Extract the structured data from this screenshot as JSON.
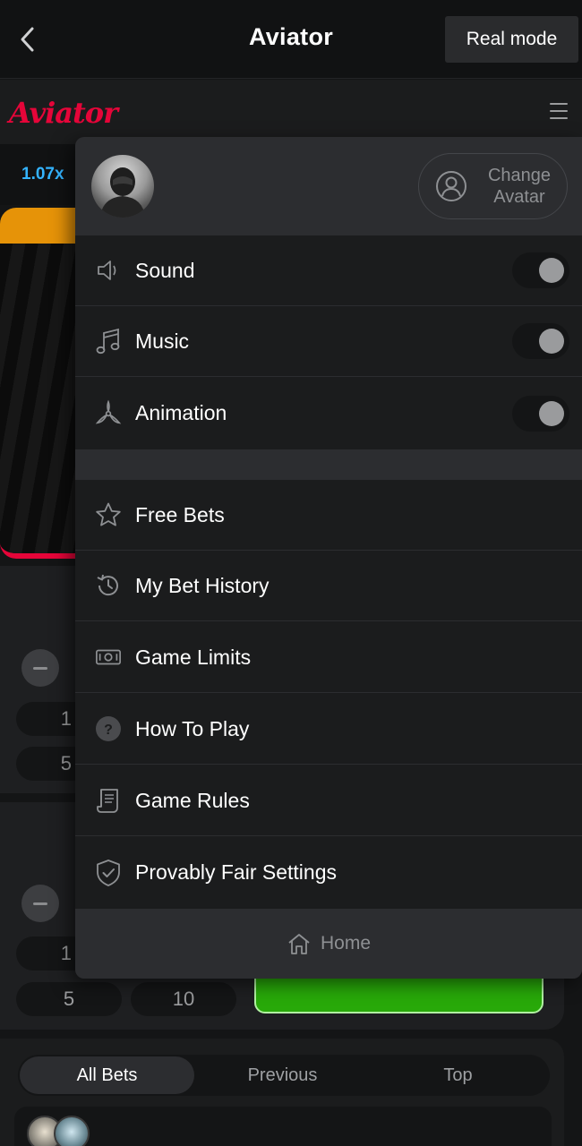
{
  "appbar": {
    "title": "Aviator",
    "mode_label": "Real mode"
  },
  "game": {
    "logo_text": "Aviator",
    "last_multiplier": "1.07x"
  },
  "bet_panels": [
    {
      "amount_1": "1",
      "amount_2": "5"
    },
    {
      "amount_1": "1",
      "amount_2": "5",
      "amount_3": "10"
    }
  ],
  "bets_tabs": {
    "tabs": [
      "All Bets",
      "Previous",
      "Top"
    ],
    "active": "All Bets"
  },
  "menu": {
    "change_avatar_label": "Change Avatar",
    "toggles": [
      {
        "label": "Sound",
        "icon": "speaker-icon",
        "on": false
      },
      {
        "label": "Music",
        "icon": "music-note-icon",
        "on": false
      },
      {
        "label": "Animation",
        "icon": "propeller-icon",
        "on": false
      }
    ],
    "links": [
      {
        "label": "Free Bets",
        "icon": "star-icon"
      },
      {
        "label": "My Bet History",
        "icon": "history-icon"
      },
      {
        "label": "Game Limits",
        "icon": "banknote-icon"
      },
      {
        "label": "How To Play",
        "icon": "question-icon"
      },
      {
        "label": "Game Rules",
        "icon": "scroll-icon"
      },
      {
        "label": "Provably Fair Settings",
        "icon": "shield-check-icon"
      }
    ],
    "home_label": "Home"
  },
  "colors": {
    "brand_red": "#e50539",
    "multiplier_blue": "#34b4ff",
    "bet_green": "#28a909",
    "menu_bg": "#1b1c1d",
    "toggle_knob_off": "#9a9b9d"
  }
}
